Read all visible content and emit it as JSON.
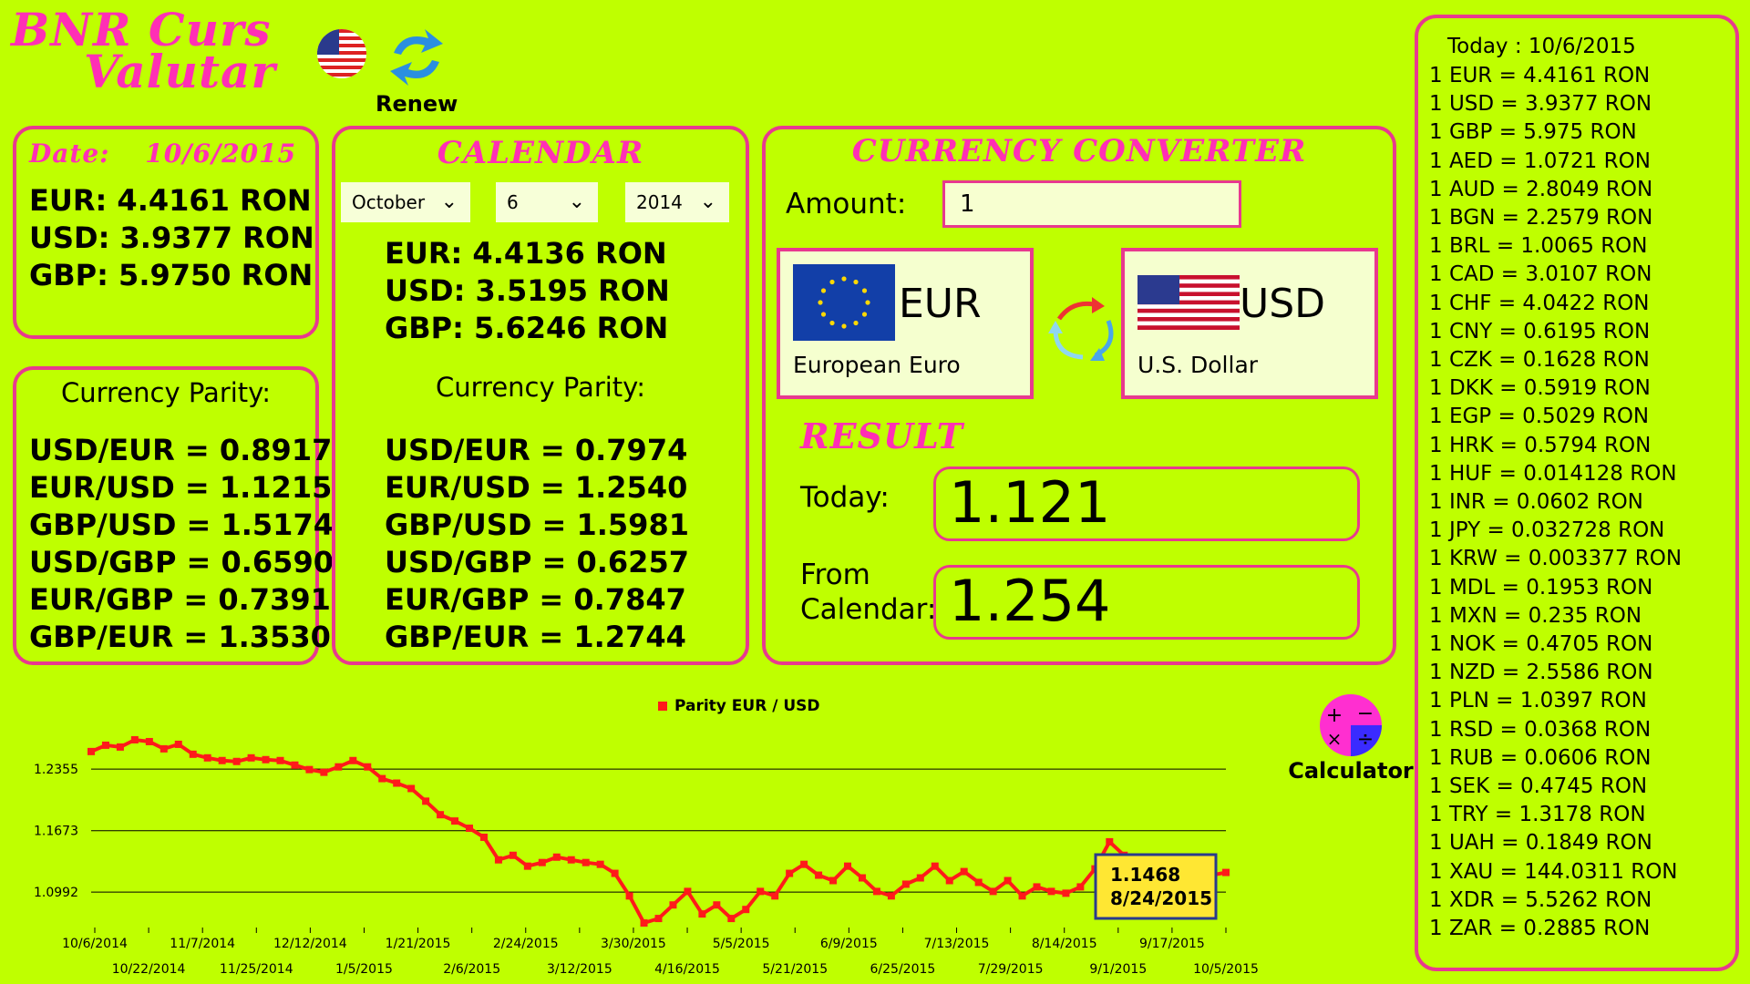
{
  "app": {
    "title_line1": "BNR Curs",
    "title_line2": "Valutar",
    "renew_label": "Renew",
    "calculator_label": "Calculator"
  },
  "today_panel": {
    "date_label": "Date:",
    "date": "10/6/2015",
    "rates": [
      "EUR: 4.4161 RON",
      "USD: 3.9377 RON",
      "GBP: 5.9750 RON"
    ]
  },
  "today_parity": {
    "title": "Currency Parity:",
    "lines": [
      "USD/EUR = 0.8917",
      "EUR/USD = 1.1215",
      "GBP/USD = 1.5174",
      "USD/GBP = 0.6590",
      "EUR/GBP = 0.7391",
      "GBP/EUR = 1.3530"
    ]
  },
  "calendar": {
    "title": "CALENDAR",
    "month": "October",
    "day": "6",
    "year": "2014",
    "rates": [
      "EUR: 4.4136 RON",
      "USD: 3.5195 RON",
      "GBP: 5.6246 RON"
    ],
    "parity_title": "Currency Parity:",
    "parity_lines": [
      "USD/EUR = 0.7974",
      "EUR/USD = 1.2540",
      "GBP/USD = 1.5981",
      "USD/GBP = 0.6257",
      "EUR/GBP = 0.7847",
      "GBP/EUR = 1.2744"
    ]
  },
  "converter": {
    "title": "CURRENCY CONVERTER",
    "amount_label": "Amount:",
    "amount_value": "1",
    "from_code": "EUR",
    "from_name": "European Euro",
    "to_code": "USD",
    "to_name": "U.S. Dollar",
    "result_title": "RESULT",
    "today_label": "Today:",
    "today_value": "1.121",
    "from_calendar_label_1": "From",
    "from_calendar_label_2": "Calendar:",
    "from_calendar_value": "1.254"
  },
  "rates_list": {
    "header": "Today : 10/6/2015",
    "items": [
      "1 EUR = 4.4161 RON",
      "1 USD = 3.9377 RON",
      "1 GBP = 5.975 RON",
      "1 AED = 1.0721 RON",
      "1 AUD = 2.8049 RON",
      "1 BGN = 2.2579 RON",
      "1 BRL = 1.0065 RON",
      "1 CAD = 3.0107 RON",
      "1 CHF = 4.0422 RON",
      "1 CNY = 0.6195 RON",
      "1 CZK = 0.1628 RON",
      "1 DKK = 0.5919 RON",
      "1 EGP = 0.5029 RON",
      "1 HRK = 0.5794 RON",
      "1 HUF = 0.014128 RON",
      "1 INR = 0.0602 RON",
      "1 JPY = 0.032728 RON",
      "1 KRW = 0.003377 RON",
      "1 MDL = 0.1953 RON",
      "1 MXN = 0.235 RON",
      "1 NOK = 0.4705 RON",
      "1 NZD = 2.5586 RON",
      "1 PLN = 1.0397 RON",
      "1 RSD = 0.0368 RON",
      "1 RUB = 0.0606 RON",
      "1 SEK = 0.4745 RON",
      "1 TRY = 1.3178 RON",
      "1 UAH = 0.1849 RON",
      "1 XAU = 144.0311 RON",
      "1 XDR = 5.5262 RON",
      "1 ZAR = 0.2885 RON"
    ]
  },
  "chart_data": {
    "type": "line",
    "legend": "Parity EUR / USD",
    "series_color": "#ff1a1a",
    "y_ticks": [
      "1.2355",
      "1.1673",
      "1.0992"
    ],
    "y_tick_values": [
      1.2355,
      1.1673,
      1.0992
    ],
    "ylim": [
      1.06,
      1.27
    ],
    "x_labels_top": [
      "10/6/2014",
      "11/7/2014",
      "12/12/2014",
      "1/21/2015",
      "2/24/2015",
      "3/30/2015",
      "5/5/2015",
      "6/9/2015",
      "7/13/2015",
      "8/14/2015",
      "9/17/2015"
    ],
    "x_labels_bottom": [
      "10/22/2014",
      "11/25/2014",
      "1/5/2015",
      "2/6/2015",
      "3/12/2015",
      "4/16/2015",
      "5/21/2015",
      "6/25/2015",
      "7/29/2015",
      "9/1/2015",
      "10/5/2015"
    ],
    "values": [
      1.255,
      1.262,
      1.26,
      1.268,
      1.266,
      1.258,
      1.263,
      1.252,
      1.248,
      1.245,
      1.244,
      1.248,
      1.246,
      1.245,
      1.24,
      1.235,
      1.232,
      1.238,
      1.245,
      1.238,
      1.225,
      1.22,
      1.214,
      1.2,
      1.185,
      1.178,
      1.17,
      1.16,
      1.135,
      1.14,
      1.128,
      1.132,
      1.138,
      1.135,
      1.132,
      1.13,
      1.12,
      1.095,
      1.065,
      1.07,
      1.085,
      1.1,
      1.075,
      1.085,
      1.07,
      1.08,
      1.1,
      1.095,
      1.12,
      1.13,
      1.118,
      1.112,
      1.128,
      1.115,
      1.1,
      1.095,
      1.108,
      1.115,
      1.128,
      1.112,
      1.122,
      1.11,
      1.1,
      1.112,
      1.095,
      1.105,
      1.1,
      1.098,
      1.105,
      1.125,
      1.155,
      1.14,
      1.13,
      1.13,
      1.128,
      1.122,
      1.12,
      1.118,
      1.121
    ],
    "tooltip_value": "1.1468",
    "tooltip_date": "8/24/2015"
  }
}
